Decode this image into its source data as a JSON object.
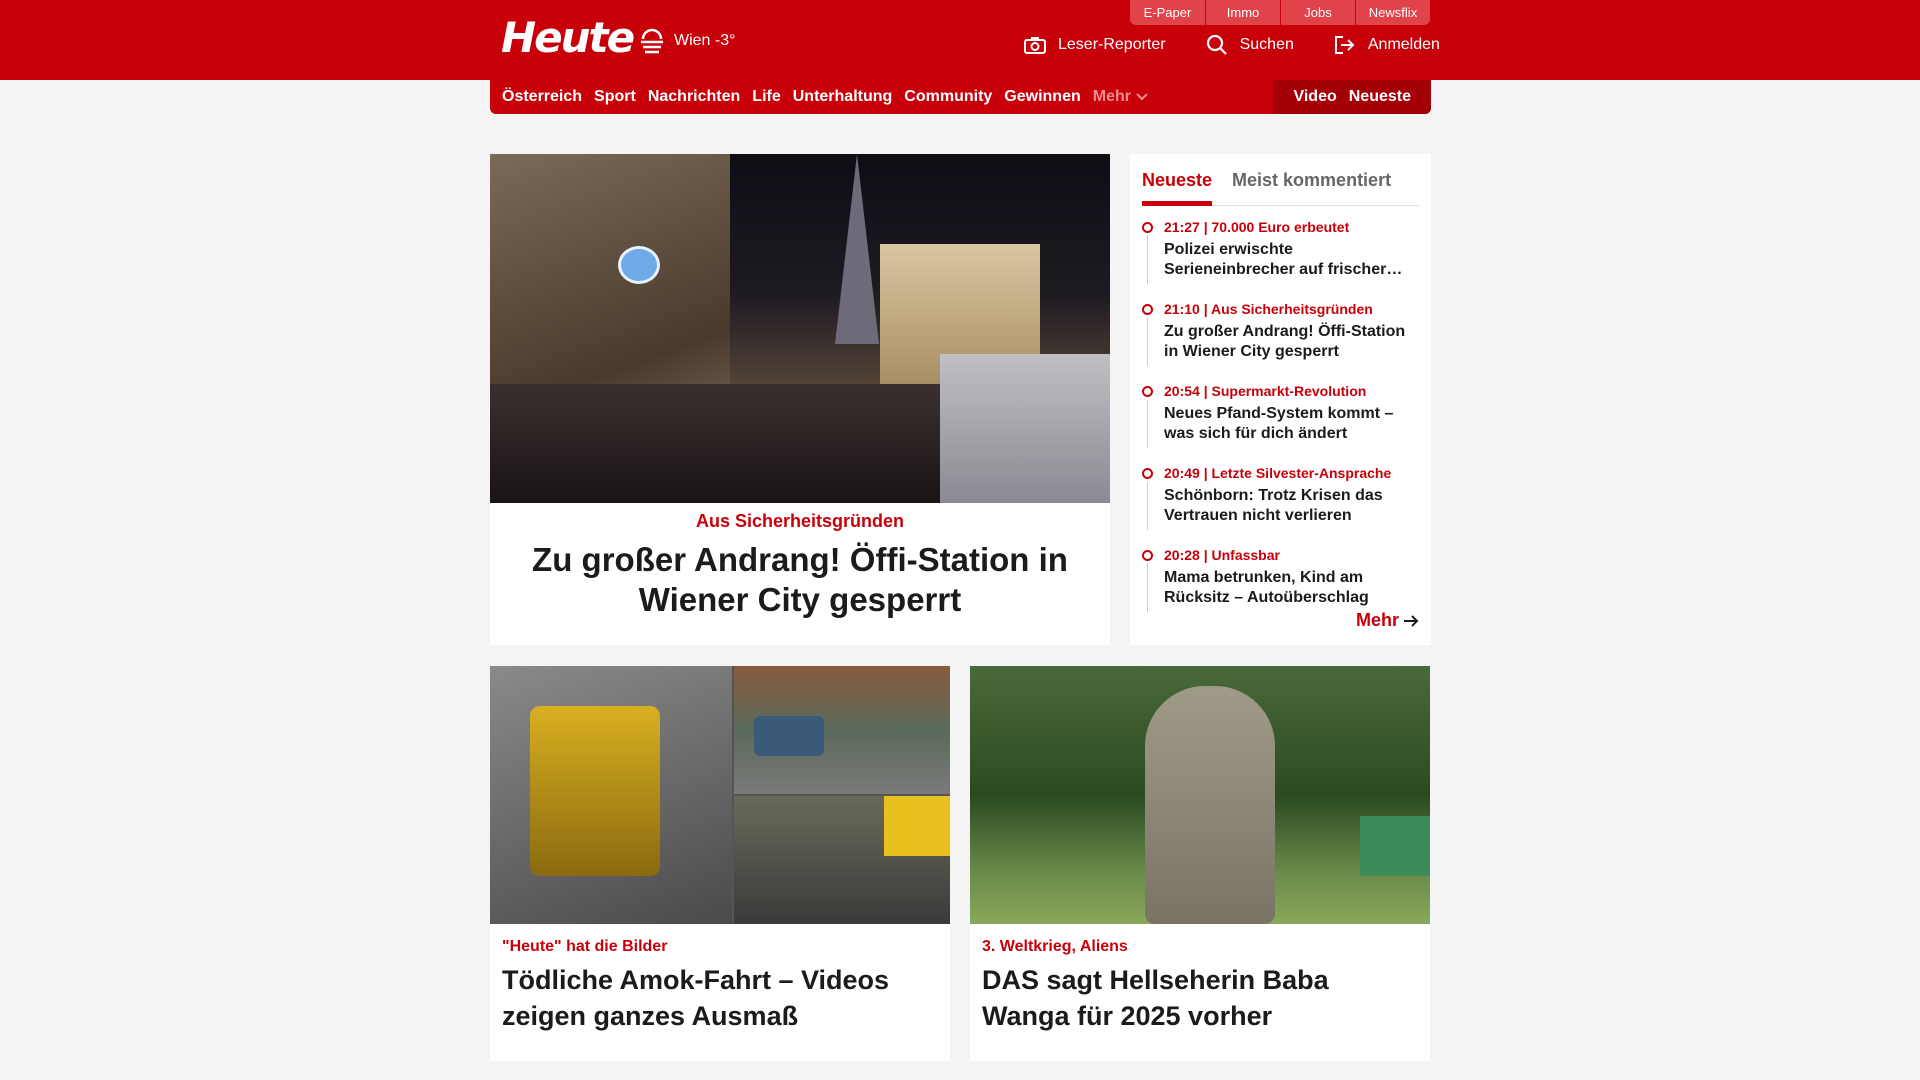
{
  "header": {
    "logo": "Heute",
    "weather": "Wien -3°",
    "top_links": [
      "E-Paper",
      "Immo",
      "Jobs",
      "Newsflix"
    ],
    "actions": {
      "reporter": "Leser-Reporter",
      "search": "Suchen",
      "login": "Anmelden"
    }
  },
  "nav": {
    "items": [
      "Österreich",
      "Sport",
      "Nachrichten",
      "Life",
      "Unterhaltung",
      "Community",
      "Gewinnen"
    ],
    "more": "Mehr",
    "video": "Video",
    "newest": "Neueste"
  },
  "hero": {
    "kicker": "Aus Sicherheitsgründen",
    "title": "Zu großer Andrang! Öffi-Station in Wiener City gesperrt"
  },
  "sidebar": {
    "tab_active": "Neueste",
    "tab_inactive": "Meist kommentiert",
    "items": [
      {
        "meta": "21:27 | 70.000 Euro erbeutet",
        "title": "Polizei erwischte Serieneinbrecher auf frischer…"
      },
      {
        "meta": "21:10 | Aus Sicherheitsgründen",
        "title": "Zu großer Andrang! Öffi-Station in Wiener City gesperrt"
      },
      {
        "meta": "20:54 | Supermarkt-Revolution",
        "title": "Neues Pfand-System kommt – was sich für dich ändert"
      },
      {
        "meta": "20:49 | Letzte Silvester-Ansprache",
        "title": "Schönborn: Trotz Krisen das Vertrauen nicht verlieren"
      },
      {
        "meta": "20:28 | Unfassbar",
        "title": "Mama betrunken, Kind am Rücksitz – Autoüberschlag"
      }
    ],
    "more": "Mehr"
  },
  "cards": [
    {
      "kicker": "\"Heute\" hat die Bilder",
      "title": "Tödliche Amok-Fahrt – Videos zeigen ganzes Ausmaß"
    },
    {
      "kicker": "3. Weltkrieg, Aliens",
      "title": "DAS sagt Hellseherin Baba Wanga für 2025 vorher"
    }
  ],
  "colors": {
    "brand": "#c8000a"
  }
}
